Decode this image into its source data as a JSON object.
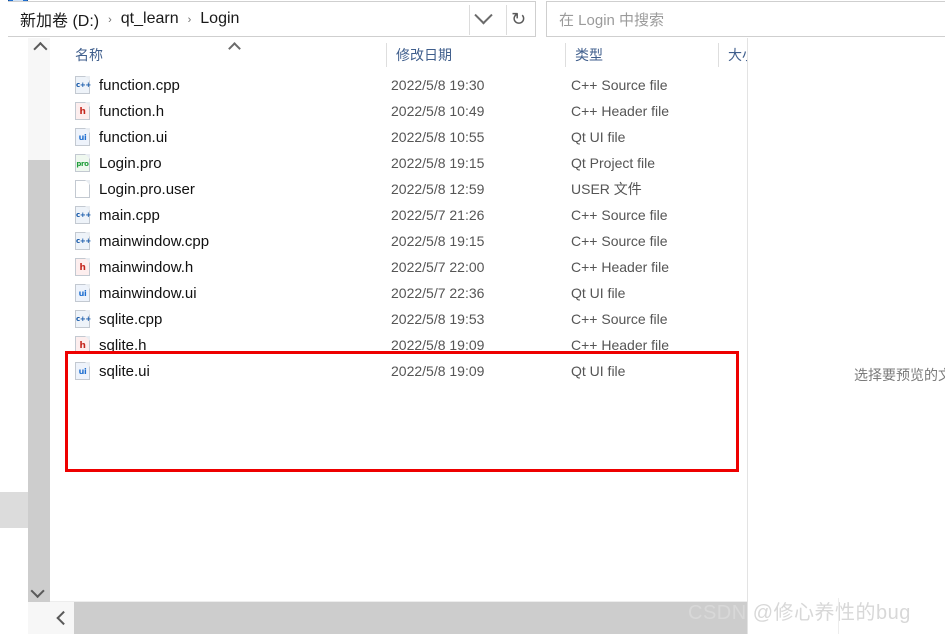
{
  "window": {
    "type": "file-explorer"
  },
  "address_bar": {
    "crumbs": [
      "新加卷 (D:)",
      "qt_learn",
      "Login"
    ],
    "separator": "›",
    "dropdown_icon": "chevron-down-icon",
    "refresh_icon": "refresh-icon",
    "refresh_glyph": "↻"
  },
  "search": {
    "placeholder": "在 Login 中搜索",
    "value": ""
  },
  "columns": [
    {
      "key": "name",
      "label": "名称",
      "sorted": true
    },
    {
      "key": "date",
      "label": "修改日期",
      "sorted": false
    },
    {
      "key": "type",
      "label": "类型",
      "sorted": false
    },
    {
      "key": "size",
      "label": "大小",
      "sorted": false
    }
  ],
  "files": [
    {
      "icon": "cpp",
      "tag": "c++",
      "name": "function.cpp",
      "date": "2022/5/8 19:30",
      "type": "C++ Source file"
    },
    {
      "icon": "h",
      "tag": "h",
      "name": "function.h",
      "date": "2022/5/8 10:49",
      "type": "C++ Header file"
    },
    {
      "icon": "ui",
      "tag": "ui",
      "name": "function.ui",
      "date": "2022/5/8 10:55",
      "type": "Qt UI file"
    },
    {
      "icon": "pro",
      "tag": "pro",
      "name": "Login.pro",
      "date": "2022/5/8 19:15",
      "type": "Qt Project file"
    },
    {
      "icon": "blank",
      "tag": "",
      "name": "Login.pro.user",
      "date": "2022/5/8 12:59",
      "type": "USER 文件"
    },
    {
      "icon": "cpp",
      "tag": "c++",
      "name": "main.cpp",
      "date": "2022/5/7 21:26",
      "type": "C++ Source file"
    },
    {
      "icon": "cpp",
      "tag": "c++",
      "name": "mainwindow.cpp",
      "date": "2022/5/8 19:15",
      "type": "C++ Source file"
    },
    {
      "icon": "h",
      "tag": "h",
      "name": "mainwindow.h",
      "date": "2022/5/7 22:00",
      "type": "C++ Header file"
    },
    {
      "icon": "ui",
      "tag": "ui",
      "name": "mainwindow.ui",
      "date": "2022/5/7 22:36",
      "type": "Qt UI file"
    },
    {
      "icon": "cpp",
      "tag": "c++",
      "name": "sqlite.cpp",
      "date": "2022/5/8 19:53",
      "type": "C++ Source file"
    },
    {
      "icon": "h",
      "tag": "h",
      "name": "sqlite.h",
      "date": "2022/5/8 19:09",
      "type": "C++ Header file"
    },
    {
      "icon": "ui",
      "tag": "ui",
      "name": "sqlite.ui",
      "date": "2022/5/8 19:09",
      "type": "Qt UI file"
    }
  ],
  "annotation": {
    "shape": "rectangle",
    "color": "#ee0000",
    "covers": [
      "sqlite.cpp",
      "sqlite.h",
      "sqlite.ui"
    ]
  },
  "preview_pane": {
    "message": "选择要预览的文件"
  },
  "scrollbars": {
    "vertical_up_icon": "caret-up-icon",
    "vertical_down_icon": "caret-down-icon",
    "horizontal_left_icon": "caret-left-icon"
  },
  "watermark": {
    "text": "CSDN @修心养性的bug"
  }
}
